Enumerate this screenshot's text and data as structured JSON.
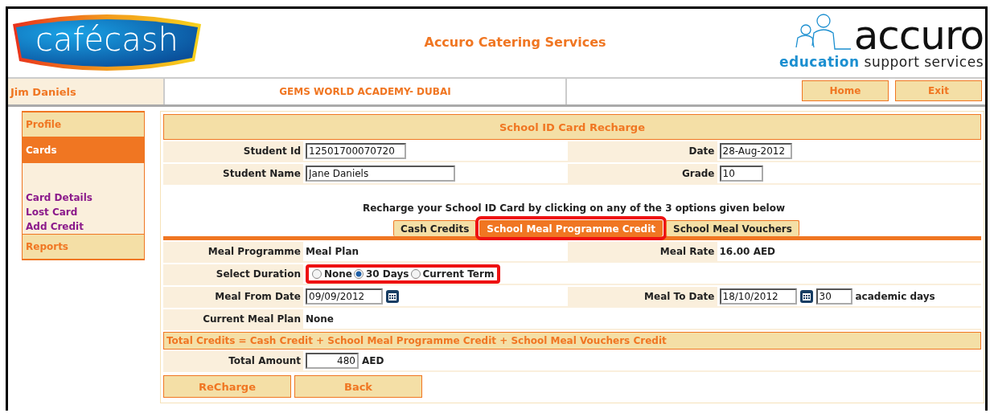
{
  "header": {
    "logo_text": "cafécash",
    "title": "Accuro Catering Services",
    "brand_name": "accuro",
    "brand_tagline": "**education** support services"
  },
  "top_bar": {
    "user": "Jim Daniels",
    "school": "GEMS WORLD ACADEMY- DUBAI",
    "buttons": [
      "Home",
      "Exit"
    ]
  },
  "sidebar": {
    "items": [
      {
        "label": "Profile",
        "kind": "section",
        "selected": false
      },
      {
        "label": "Cards",
        "kind": "section",
        "selected": true
      },
      {
        "label": "Card Details",
        "kind": "link",
        "selected": false
      },
      {
        "label": "Lost Card",
        "kind": "link",
        "selected": false
      },
      {
        "label": "Add Credit",
        "kind": "link",
        "selected": false
      },
      {
        "label": "Reports",
        "kind": "section",
        "selected": false
      }
    ]
  },
  "form": {
    "title": "School ID Card Recharge",
    "rows": [
      {
        "label": "Student Id",
        "value": "12501700070720",
        "label_2": "Date",
        "value_2": "28-Aug-2012"
      },
      {
        "label": "Student Name",
        "value": "Jane Daniels",
        "label_2": "Grade",
        "value_2": "10"
      }
    ],
    "instruction": "Recharge your School ID Card by clicking on any of the 3 options given below",
    "tabs": [
      {
        "label": "Cash Credits",
        "selected": false,
        "highlighted": false
      },
      {
        "label": "School Meal Programme Credit",
        "selected": true,
        "highlighted": true
      },
      {
        "label": "School Meal Vouchers",
        "selected": false,
        "highlighted": false
      }
    ],
    "meal_programme": {
      "label": "Meal Programme",
      "value": "Meal Plan"
    },
    "meal_rate": {
      "label": "Meal Rate",
      "value": "16.00 AED"
    },
    "duration": {
      "label": "Select Duration",
      "highlighted": true,
      "options": [
        {
          "label": "None",
          "selected": false
        },
        {
          "label": "30 Days",
          "selected": true
        },
        {
          "label": "Current Term",
          "selected": false
        }
      ]
    },
    "meal_from": {
      "label": "Meal From Date",
      "value": "09/09/2012"
    },
    "meal_to": {
      "label": "Meal To Date",
      "value": "18/10/2012",
      "days": "30",
      "days_unit": "academic days"
    },
    "current_plan": {
      "label": "Current Meal Plan",
      "value": "None"
    },
    "total_note": "Total Credits = Cash Credit + School Meal Programme Credit + School Meal Vouchers Credit",
    "total": {
      "label": "Total Amount",
      "value": "480",
      "unit": "AED"
    },
    "buttons": [
      "ReCharge",
      "Back"
    ]
  }
}
